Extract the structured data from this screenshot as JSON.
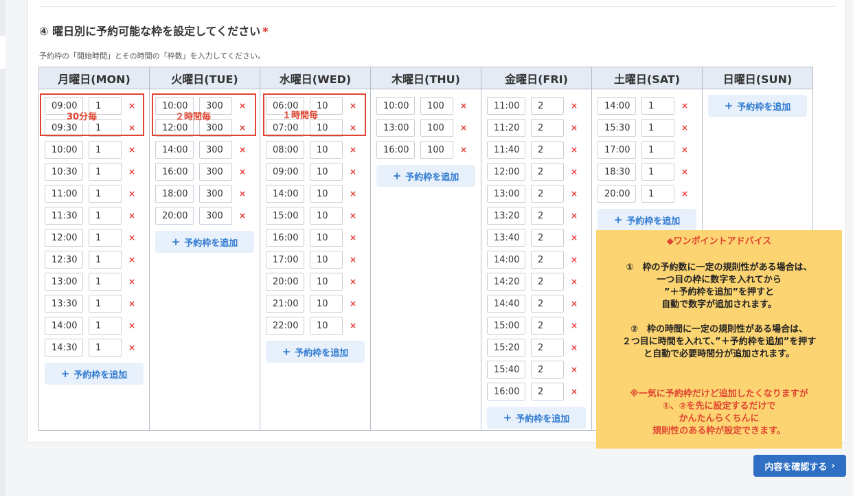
{
  "section": {
    "title": "④ 曜日別に予約可能な枠を設定してください",
    "required_mark": "*",
    "description": "予約枠の「開始時間」とその時間の「枠数」を入力してください。"
  },
  "add_label": "予約枠を追加",
  "add_icon": "+",
  "delete_icon": "×",
  "days": [
    {
      "header": "月曜日(MON)",
      "slots": [
        [
          "09:00",
          "1"
        ],
        [
          "09:30",
          "1"
        ],
        [
          "10:00",
          "1"
        ],
        [
          "10:30",
          "1"
        ],
        [
          "11:00",
          "1"
        ],
        [
          "11:30",
          "1"
        ],
        [
          "12:00",
          "1"
        ],
        [
          "12:30",
          "1"
        ],
        [
          "13:00",
          "1"
        ],
        [
          "13:30",
          "1"
        ],
        [
          "14:00",
          "1"
        ],
        [
          "14:30",
          "1"
        ]
      ]
    },
    {
      "header": "火曜日(TUE)",
      "slots": [
        [
          "10:00",
          "300"
        ],
        [
          "12:00",
          "300"
        ],
        [
          "14:00",
          "300"
        ],
        [
          "16:00",
          "300"
        ],
        [
          "18:00",
          "300"
        ],
        [
          "20:00",
          "300"
        ]
      ]
    },
    {
      "header": "水曜日(WED)",
      "slots": [
        [
          "06:00",
          "10"
        ],
        [
          "07:00",
          "10"
        ],
        [
          "08:00",
          "10"
        ],
        [
          "09:00",
          "10"
        ],
        [
          "14:00",
          "10"
        ],
        [
          "15:00",
          "10"
        ],
        [
          "16:00",
          "10"
        ],
        [
          "17:00",
          "10"
        ],
        [
          "20:00",
          "10"
        ],
        [
          "21:00",
          "10"
        ],
        [
          "22:00",
          "10"
        ]
      ]
    },
    {
      "header": "木曜日(THU)",
      "slots": [
        [
          "10:00",
          "100"
        ],
        [
          "13:00",
          "100"
        ],
        [
          "16:00",
          "100"
        ]
      ]
    },
    {
      "header": "金曜日(FRI)",
      "slots": [
        [
          "11:00",
          "2"
        ],
        [
          "11:20",
          "2"
        ],
        [
          "11:40",
          "2"
        ],
        [
          "12:00",
          "2"
        ],
        [
          "13:00",
          "2"
        ],
        [
          "13:20",
          "2"
        ],
        [
          "13:40",
          "2"
        ],
        [
          "14:00",
          "2"
        ],
        [
          "14:20",
          "2"
        ],
        [
          "14:40",
          "2"
        ],
        [
          "15:00",
          "2"
        ],
        [
          "15:20",
          "2"
        ],
        [
          "15:40",
          "2"
        ],
        [
          "16:00",
          "2"
        ]
      ]
    },
    {
      "header": "土曜日(SAT)",
      "slots": [
        [
          "14:00",
          "1"
        ],
        [
          "15:30",
          "1"
        ],
        [
          "17:00",
          "1"
        ],
        [
          "18:30",
          "1"
        ],
        [
          "20:00",
          "1"
        ]
      ]
    },
    {
      "header": "日曜日(SUN)",
      "slots": []
    }
  ],
  "annotations": {
    "mon": "30分毎",
    "tue": "２時間毎",
    "wed": "１時間毎"
  },
  "advice": {
    "title": "◆ワンポイントアドバイス",
    "para1": [
      "①　枠の予約数に一定の規則性がある場合は、",
      "一つ目の枠に数字を入れてから",
      "”＋予約枠を追加”を押すと",
      "自動で数字が追加されます。"
    ],
    "para2": [
      "②　枠の時間に一定の規則性がある場合は、",
      "２つ目に時間を入れて、”＋予約枠を追加”を押す",
      "と自動で必要時間分が追加されます。"
    ],
    "note": [
      "※一気に予約枠だけど追加したくなりますが",
      "①、②を先に設定するだけで",
      "かんたんらくちんに",
      "規則性のある枠が設定できます。"
    ]
  },
  "confirm_button": {
    "label": "内容を確認する",
    "chevron": "›"
  },
  "colors": {
    "accent": "#2f7ad1",
    "delete": "#e53935",
    "highlight": "#e0432f",
    "advice_bg": "#fcd572"
  }
}
